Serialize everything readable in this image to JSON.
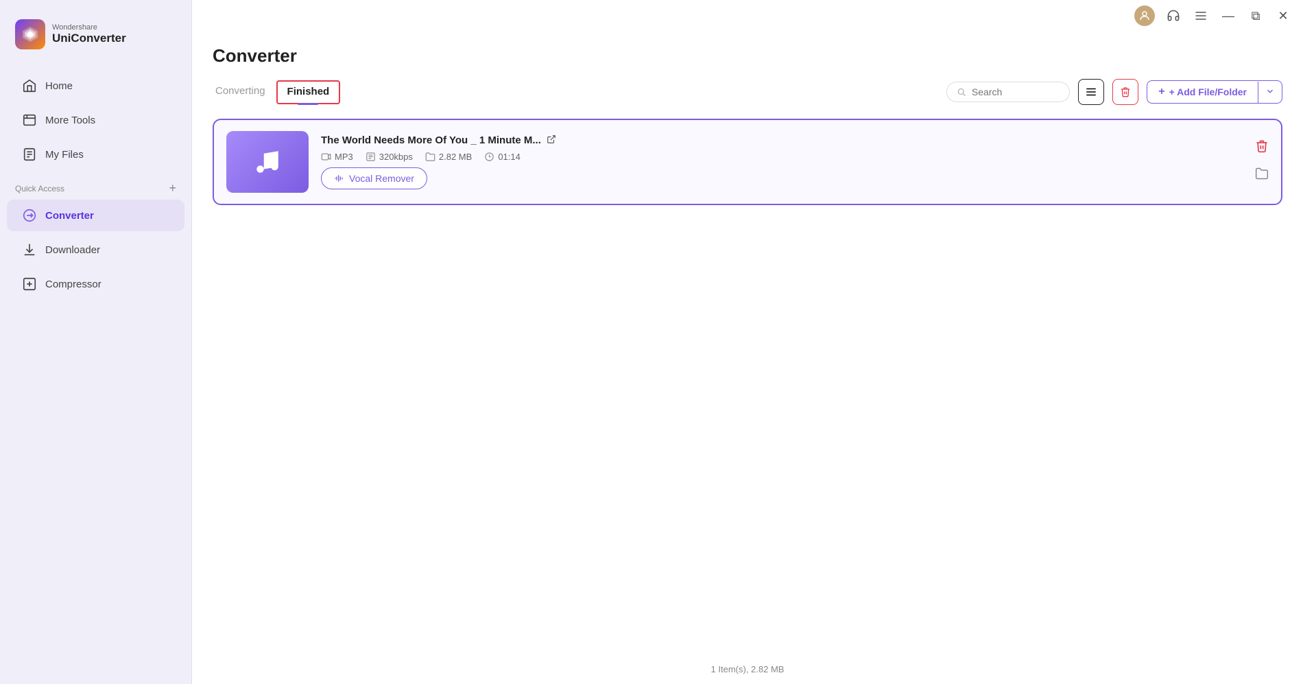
{
  "app": {
    "brand": "Wondershare",
    "name": "UniConverter"
  },
  "titlebar": {
    "minimize_label": "—",
    "maximize_label": "⧉",
    "close_label": "✕"
  },
  "sidebar": {
    "nav_items": [
      {
        "id": "home",
        "label": "Home",
        "icon": "home-icon"
      },
      {
        "id": "more-tools",
        "label": "More Tools",
        "icon": "tools-icon"
      },
      {
        "id": "my-files",
        "label": "My Files",
        "icon": "files-icon"
      }
    ],
    "quick_access_label": "Quick Access",
    "quick_access_items": [
      {
        "id": "converter",
        "label": "Converter",
        "icon": "converter-icon",
        "active": true
      },
      {
        "id": "downloader",
        "label": "Downloader",
        "icon": "downloader-icon"
      },
      {
        "id": "compressor",
        "label": "Compressor",
        "icon": "compressor-icon"
      }
    ]
  },
  "page": {
    "title": "Converter",
    "tabs": [
      {
        "id": "converting",
        "label": "Converting",
        "active": false
      },
      {
        "id": "finished",
        "label": "Finished",
        "active": true
      }
    ]
  },
  "toolbar": {
    "search_placeholder": "Search",
    "list_view_label": "≡",
    "delete_label": "🗑",
    "add_file_label": "+ Add File/Folder",
    "dropdown_label": "▾"
  },
  "files": [
    {
      "title": "The World Needs More Of You _ 1 Minute M...",
      "format": "MP3",
      "bitrate": "320kbps",
      "size": "2.82 MB",
      "duration": "01:14",
      "vocal_remover_label": "Vocal Remover"
    }
  ],
  "status_bar": {
    "text": "1 Item(s), 2.82 MB"
  }
}
